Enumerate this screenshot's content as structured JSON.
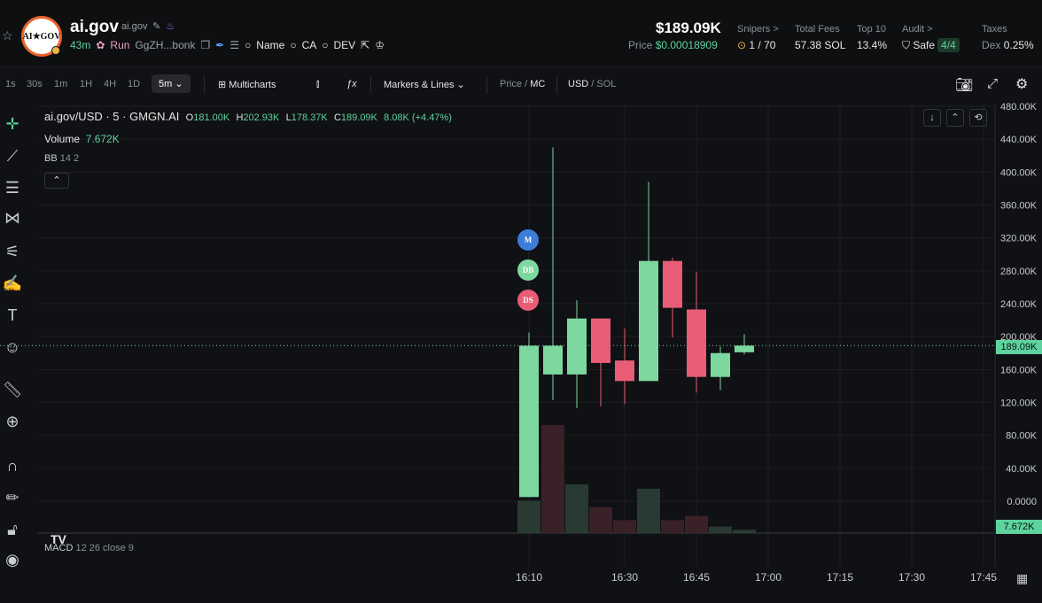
{
  "token": {
    "name": "ai.gov",
    "sub": "ai.gov",
    "logo_text": "AI★GOV",
    "age": "43m",
    "run_label": "Run",
    "address": "GgZH...bonk",
    "search_name": "Name",
    "search_ca": "CA",
    "search_dev": "DEV"
  },
  "stats": {
    "mcap": "$189.09K",
    "price_label": "Price",
    "price_value": "$0.00018909",
    "snipers_label": "Snipers >",
    "snipers_value": "1 / 70",
    "fees_label": "Total Fees",
    "fees_value": "57.38 SOL",
    "top10_label": "Top 10",
    "top10_value": "13.4%",
    "audit_label": "Audit >",
    "audit_value": "Safe",
    "audit_count": "4/4",
    "taxes_label": "Taxes",
    "taxes_dex": "Dex",
    "taxes_value": "0.25%"
  },
  "toolbar": {
    "intervals": [
      "1s",
      "30s",
      "1m",
      "1H",
      "4H",
      "1D"
    ],
    "selected_interval": "5m",
    "multicharts": "Multicharts",
    "markers": "Markers & Lines",
    "price": "Price",
    "mc": "MC",
    "usd": "USD",
    "sol": "SOL"
  },
  "legend": {
    "symbol": "ai.gov/USD · 5 · GMGN.AI",
    "o": "181.00K",
    "h": "202.93K",
    "l": "178.37K",
    "c": "189.09K",
    "change": "8.08K (+4.47%)",
    "volume_label": "Volume",
    "volume_value": "7.672K",
    "bb": "BB",
    "bb_params": "14 2",
    "macd": "MACD",
    "macd_params": "12 26 close 9",
    "tv_logo": "TV"
  },
  "markers": [
    "M",
    "DB",
    "DS"
  ],
  "price_tag": "189.09K",
  "volume_tag": "7.672K",
  "colors": {
    "up": "#7dd8a0",
    "down": "#e85d75",
    "bg": "#101114"
  },
  "chart_data": {
    "type": "candlestick",
    "y_ticks": [
      "480.00K",
      "440.00K",
      "400.00K",
      "360.00K",
      "320.00K",
      "280.00K",
      "240.00K",
      "200.00K",
      "160.00K",
      "120.00K",
      "80.00K",
      "40.00K",
      "0.0000"
    ],
    "x_ticks": [
      "16:10",
      "16:30",
      "16:45",
      "17:00",
      "17:15",
      "17:30",
      "17:45"
    ],
    "ylim": [
      0,
      480
    ],
    "candles": [
      {
        "t": "16:10",
        "o": 5,
        "h": 205,
        "l": 5,
        "c": 189
      },
      {
        "t": "16:15",
        "o": 154,
        "h": 430,
        "l": 123,
        "c": 189
      },
      {
        "t": "16:20",
        "o": 154,
        "h": 244,
        "l": 113,
        "c": 222
      },
      {
        "t": "16:25",
        "o": 222,
        "h": 222,
        "l": 115,
        "c": 168
      },
      {
        "t": "16:30",
        "o": 171,
        "h": 210,
        "l": 118,
        "c": 146
      },
      {
        "t": "16:35",
        "o": 146,
        "h": 388,
        "l": 146,
        "c": 292
      },
      {
        "t": "16:40",
        "o": 292,
        "h": 296,
        "l": 199,
        "c": 235
      },
      {
        "t": "16:45",
        "o": 233,
        "h": 279,
        "l": 132,
        "c": 151
      },
      {
        "t": "16:50",
        "o": 151,
        "h": 188,
        "l": 135,
        "c": 180
      },
      {
        "t": "16:55",
        "o": 181,
        "h": 202.93,
        "l": 178.37,
        "c": 189.09
      }
    ],
    "volume": [
      {
        "v": 0.3,
        "dir": "up"
      },
      {
        "v": 1.0,
        "dir": "down"
      },
      {
        "v": 0.45,
        "dir": "up"
      },
      {
        "v": 0.24,
        "dir": "down"
      },
      {
        "v": 0.12,
        "dir": "down"
      },
      {
        "v": 0.41,
        "dir": "up"
      },
      {
        "v": 0.12,
        "dir": "down"
      },
      {
        "v": 0.16,
        "dir": "down"
      },
      {
        "v": 0.06,
        "dir": "up"
      },
      {
        "v": 0.03,
        "dir": "up"
      }
    ]
  }
}
